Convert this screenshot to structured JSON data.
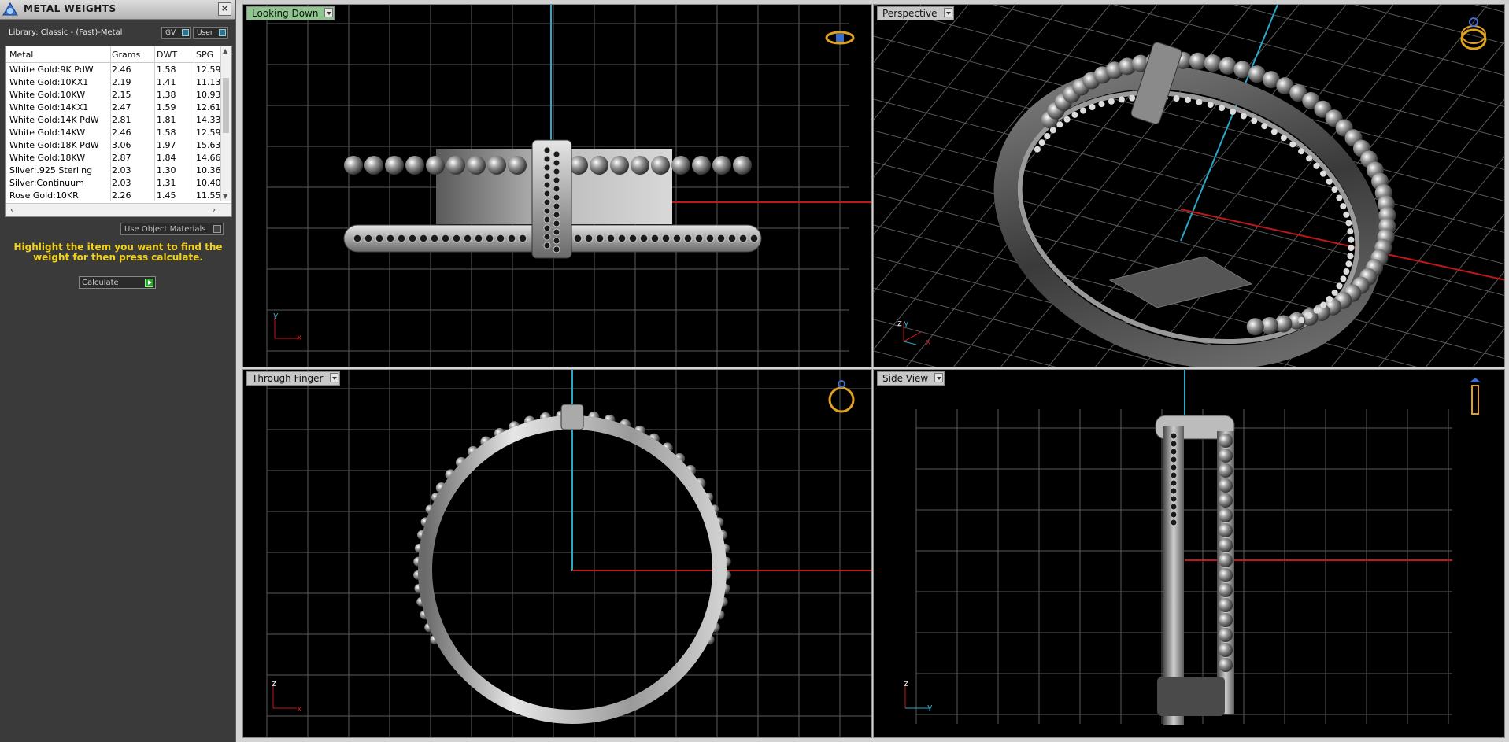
{
  "panel": {
    "title": "METAL WEIGHTS",
    "close": "×",
    "library": "Library: Classic - (Fast)-Metal",
    "toggle_gv": "GV",
    "toggle_user": "User",
    "columns": [
      "Metal",
      "Grams",
      "DWT",
      "SPG"
    ],
    "rows": [
      [
        "White Gold:9K PdW",
        "2.46",
        "1.58",
        "12.59"
      ],
      [
        "White Gold:10KX1",
        "2.19",
        "1.41",
        "11.13"
      ],
      [
        "White Gold:10KW",
        "2.15",
        "1.38",
        "10.93"
      ],
      [
        "White Gold:14KX1",
        "2.47",
        "1.59",
        "12.61"
      ],
      [
        "White Gold:14K PdW",
        "2.81",
        "1.81",
        "14.33"
      ],
      [
        "White Gold:14KW",
        "2.46",
        "1.58",
        "12.59"
      ],
      [
        "White Gold:18K PdW",
        "3.06",
        "1.97",
        "15.63"
      ],
      [
        "White Gold:18KW",
        "2.87",
        "1.84",
        "14.66"
      ],
      [
        "Silver:.925 Sterling",
        "2.03",
        "1.30",
        "10.36"
      ],
      [
        "Silver:Continuum",
        "2.03",
        "1.31",
        "10.40"
      ],
      [
        "Rose Gold:10KR",
        "2.26",
        "1.45",
        "11.55"
      ]
    ],
    "use_object_materials": "Use Object Materials",
    "hint": "Highlight the item you want to find the weight for then press calculate.",
    "calculate": "Calculate"
  },
  "viewports": {
    "top": {
      "label": "Looking Down",
      "axis_a": "y",
      "axis_b": "x"
    },
    "perspective": {
      "label": "Perspective",
      "axis_a": "y",
      "axis_b": "x",
      "axis_c": "z"
    },
    "front": {
      "label": "Through Finger",
      "axis_a": "z",
      "axis_b": "x"
    },
    "side": {
      "label": "Side View",
      "axis_a": "z",
      "axis_b": "y"
    }
  },
  "colors": {
    "grid": "#5a5a5a",
    "axis_red": "#c01818",
    "axis_cyan": "#2aa8c8",
    "active_tab": "#8fc58f",
    "hint_text": "#f2d21b",
    "icon_gold": "#e0a020"
  }
}
